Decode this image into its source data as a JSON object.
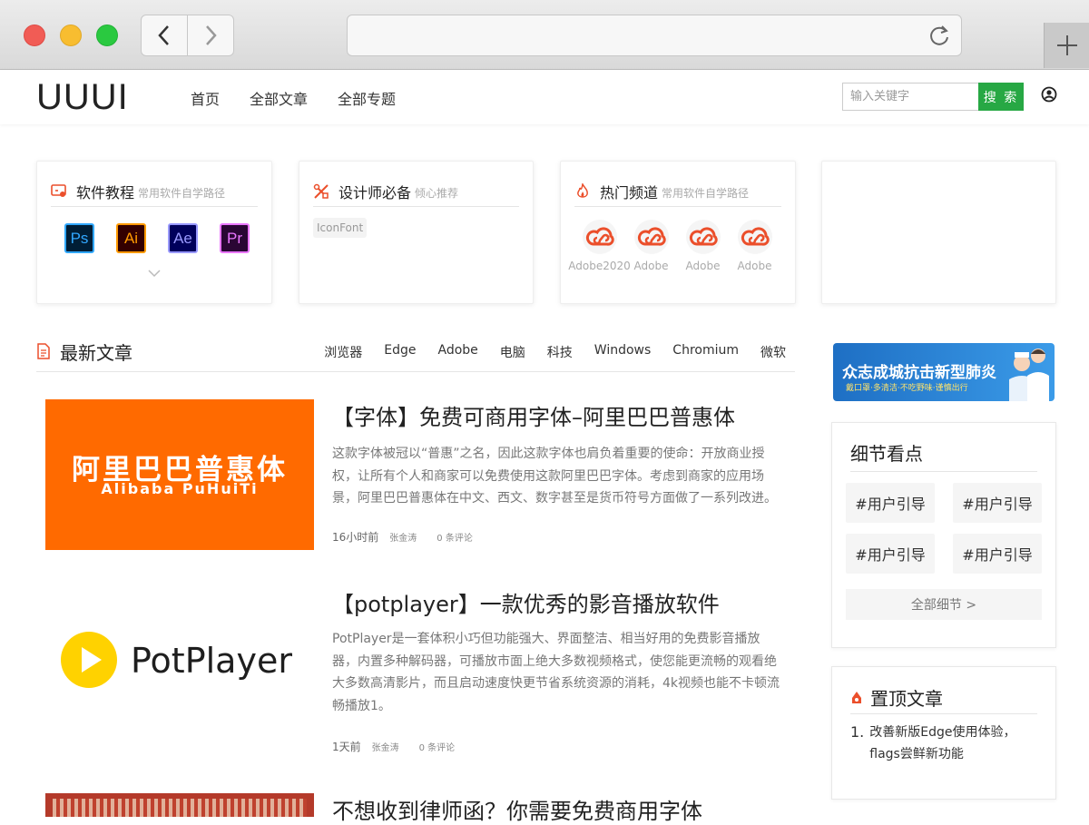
{
  "site": {
    "logo": "UUUI",
    "nav": [
      "首页",
      "全部文章",
      "全部专题"
    ],
    "search_placeholder": "输入关键字",
    "search_button": "搜 索"
  },
  "cards": {
    "software": {
      "title": "软件教程",
      "subtitle": "常用软件自学路径",
      "apps": [
        {
          "label": "Ps",
          "color": "#31a8ff",
          "bg": "#001e36"
        },
        {
          "label": "Ai",
          "color": "#ff9a00",
          "bg": "#330000"
        },
        {
          "label": "Ae",
          "color": "#9999ff",
          "bg": "#00005b"
        },
        {
          "label": "Pr",
          "color": "#ea77ff",
          "bg": "#2a0634"
        }
      ]
    },
    "designer": {
      "title": "设计师必备",
      "subtitle": "倾心推荐",
      "tag": "IconFont"
    },
    "hot": {
      "title": "热门频道",
      "subtitle": "常用软件自学路径",
      "items": [
        "Adobe2020",
        "Adobe",
        "Adobe",
        "Adobe"
      ]
    }
  },
  "latest": {
    "title": "最新文章",
    "tags": [
      "浏览器",
      "Edge",
      "Adobe",
      "电脑",
      "科技",
      "Windows",
      "Chromium",
      "微软"
    ],
    "articles": [
      {
        "title": "【字体】免费可商用字体–阿里巴巴普惠体",
        "thumb_text_cn": "阿里巴巴普惠体",
        "thumb_text_en": "Alibaba PuHuiTi",
        "desc": "这款字体被冠以“普惠”之名，因此这款字体也肩负着重要的使命：开放商业授权，让所有个人和商家可以免费使用这款阿里巴巴字体。考虑到商家的应用场景，阿里巴巴普惠体在中文、西文、数字甚至是货币符号方面做了一系列改进。",
        "time": "16小时前",
        "author": "张金涛",
        "comments": "0 条评论"
      },
      {
        "title": "【potplayer】一款优秀的影音播放软件",
        "thumb_text": "PotPlayer",
        "desc": "PotPlayer是一套体积小巧但功能强大、界面整洁、相当好用的免费影音播放器，内置多种解码器，可播放市面上绝大多数视频格式，使您能更流畅的观看绝大多数高清影片，而且启动速度快更节省系统资源的消耗，4k视频也能不卡顿流畅播放1。",
        "time": "1天前",
        "author": "张金涛",
        "comments": "0 条评论"
      },
      {
        "title": "不想收到律师函？你需要免费商用字体"
      }
    ]
  },
  "sidebar": {
    "banner_title": "众志成城抗击新型肺炎",
    "banner_sub": "戴口罩·多清洁·不吃野味·谨慎出行",
    "details_title": "细节看点",
    "detail_tags": [
      "#用户引导",
      "#用户引导",
      "#用户引导",
      "#用户引导"
    ],
    "all_details": "全部细节 >",
    "pinned_title": "置顶文章",
    "pinned": [
      {
        "num": "1.",
        "text": "改善新版Edge使用体验，flags尝鲜新功能"
      }
    ]
  },
  "colors": {
    "accent_green": "#27a844",
    "adobe_red": "#eb4f2b",
    "thumb_orange": "#ff6a00"
  }
}
